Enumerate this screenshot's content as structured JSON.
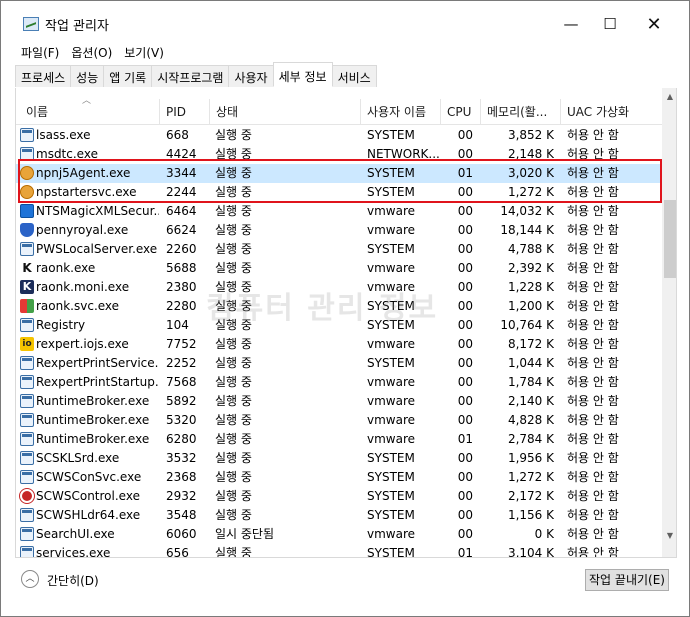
{
  "window": {
    "title": "작업 관리자"
  },
  "controls": {
    "minimize": "—",
    "maximize": "☐",
    "close": "✕"
  },
  "menu": [
    "파일(F)",
    "옵션(O)",
    "보기(V)"
  ],
  "tabs": [
    "프로세스",
    "성능",
    "앱 기록",
    "시작프로그램",
    "사용자",
    "세부 정보",
    "서비스"
  ],
  "active_tab_index": 5,
  "columns": [
    "이름",
    "PID",
    "상태",
    "사용자 이름",
    "CPU",
    "메모리(활...",
    "UAC 가상화"
  ],
  "rows": [
    {
      "name": "lsass.exe",
      "pid": "668",
      "state": "실행 중",
      "user": "SYSTEM",
      "cpu": "00",
      "mem": "3,852 K",
      "uac": "허용 안 함",
      "icon": "generic-app-icon"
    },
    {
      "name": "msdtc.exe",
      "pid": "4424",
      "state": "실행 중",
      "user": "NETWORK...",
      "cpu": "00",
      "mem": "2,148 K",
      "uac": "허용 안 함",
      "icon": "generic-app-icon"
    },
    {
      "name": "npnj5Agent.exe",
      "pid": "3344",
      "state": "실행 중",
      "user": "SYSTEM",
      "cpu": "01",
      "mem": "3,020 K",
      "uac": "허용 안 함",
      "icon": "shield-orange-icon"
    },
    {
      "name": "npstartersvc.exe",
      "pid": "2244",
      "state": "실행 중",
      "user": "SYSTEM",
      "cpu": "00",
      "mem": "1,272 K",
      "uac": "허용 안 함",
      "icon": "shield-orange-icon"
    },
    {
      "name": "NTSMagicXMLSecur...",
      "pid": "6464",
      "state": "실행 중",
      "user": "vmware",
      "cpu": "00",
      "mem": "14,032 K",
      "uac": "허용 안 함",
      "icon": "grid-blue-icon"
    },
    {
      "name": "pennyroyal.exe",
      "pid": "6624",
      "state": "실행 중",
      "user": "vmware",
      "cpu": "00",
      "mem": "18,144 K",
      "uac": "허용 안 함",
      "icon": "shield-blue-icon"
    },
    {
      "name": "PWSLocalServer.exe",
      "pid": "2260",
      "state": "실행 중",
      "user": "SYSTEM",
      "cpu": "00",
      "mem": "4,788 K",
      "uac": "허용 안 함",
      "icon": "generic-app-icon"
    },
    {
      "name": "raonk.exe",
      "pid": "5688",
      "state": "실행 중",
      "user": "vmware",
      "cpu": "00",
      "mem": "2,392 K",
      "uac": "허용 안 함",
      "icon": "k-letter-icon"
    },
    {
      "name": "raonk.moni.exe",
      "pid": "2380",
      "state": "실행 중",
      "user": "vmware",
      "cpu": "00",
      "mem": "1,228 K",
      "uac": "허용 안 함",
      "icon": "k-dark-icon"
    },
    {
      "name": "raonk.svc.exe",
      "pid": "2280",
      "state": "실행 중",
      "user": "SYSTEM",
      "cpu": "00",
      "mem": "1,200 K",
      "uac": "허용 안 함",
      "icon": "color-blocks-icon"
    },
    {
      "name": "Registry",
      "pid": "104",
      "state": "실행 중",
      "user": "SYSTEM",
      "cpu": "00",
      "mem": "10,764 K",
      "uac": "허용 안 함",
      "icon": "generic-app-icon"
    },
    {
      "name": "rexpert.iojs.exe",
      "pid": "7752",
      "state": "실행 중",
      "user": "vmware",
      "cpu": "00",
      "mem": "8,172 K",
      "uac": "허용 안 함",
      "icon": "io-icon"
    },
    {
      "name": "RexpertPrintService....",
      "pid": "2252",
      "state": "실행 중",
      "user": "SYSTEM",
      "cpu": "00",
      "mem": "1,044 K",
      "uac": "허용 안 함",
      "icon": "generic-app-icon"
    },
    {
      "name": "RexpertPrintStartup....",
      "pid": "7568",
      "state": "실행 중",
      "user": "vmware",
      "cpu": "00",
      "mem": "1,784 K",
      "uac": "허용 안 함",
      "icon": "generic-app-icon"
    },
    {
      "name": "RuntimeBroker.exe",
      "pid": "5892",
      "state": "실행 중",
      "user": "vmware",
      "cpu": "00",
      "mem": "2,140 K",
      "uac": "허용 안 함",
      "icon": "generic-app-icon"
    },
    {
      "name": "RuntimeBroker.exe",
      "pid": "5320",
      "state": "실행 중",
      "user": "vmware",
      "cpu": "00",
      "mem": "4,828 K",
      "uac": "허용 안 함",
      "icon": "generic-app-icon"
    },
    {
      "name": "RuntimeBroker.exe",
      "pid": "6280",
      "state": "실행 중",
      "user": "vmware",
      "cpu": "01",
      "mem": "2,784 K",
      "uac": "허용 안 함",
      "icon": "generic-app-icon"
    },
    {
      "name": "SCSKLSrd.exe",
      "pid": "3532",
      "state": "실행 중",
      "user": "SYSTEM",
      "cpu": "00",
      "mem": "1,956 K",
      "uac": "허용 안 함",
      "icon": "generic-app-icon"
    },
    {
      "name": "SCWSConSvc.exe",
      "pid": "2368",
      "state": "실행 중",
      "user": "SYSTEM",
      "cpu": "00",
      "mem": "1,272 K",
      "uac": "허용 안 함",
      "icon": "generic-app-icon"
    },
    {
      "name": "SCWSControl.exe",
      "pid": "2932",
      "state": "실행 중",
      "user": "SYSTEM",
      "cpu": "00",
      "mem": "2,172 K",
      "uac": "허용 안 함",
      "icon": "red-circle-icon"
    },
    {
      "name": "SCWSHLdr64.exe",
      "pid": "3548",
      "state": "실행 중",
      "user": "SYSTEM",
      "cpu": "00",
      "mem": "1,156 K",
      "uac": "허용 안 함",
      "icon": "generic-app-icon"
    },
    {
      "name": "SearchUI.exe",
      "pid": "6060",
      "state": "일시 중단됨",
      "user": "vmware",
      "cpu": "00",
      "mem": "0 K",
      "uac": "허용 안 함",
      "icon": "generic-app-icon"
    },
    {
      "name": "services.exe",
      "pid": "656",
      "state": "실행 중",
      "user": "SYSTEM",
      "cpu": "01",
      "mem": "3,104 K",
      "uac": "허용 안 함",
      "icon": "generic-app-icon"
    }
  ],
  "selected_row_index": 2,
  "watermark": "컴퓨터 관리 정보",
  "footer": {
    "collapse_label": "간단히(D)",
    "end_task_label": "작업 끝내기(E)"
  },
  "colors": {
    "selection": "#cce8ff",
    "highlight_border": "#e0141c"
  }
}
